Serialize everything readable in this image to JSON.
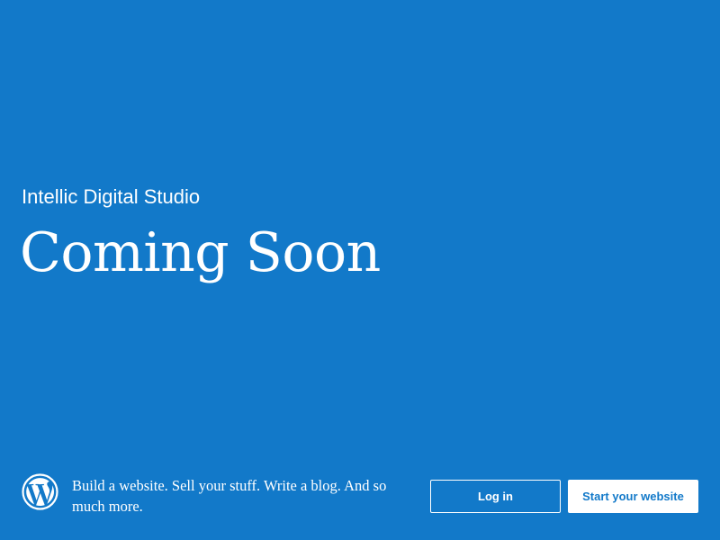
{
  "site": {
    "name": "Intellic Digital Studio",
    "headline": "Coming Soon"
  },
  "footer": {
    "logo_icon": "wordpress-logo-icon",
    "tagline": "Build a website. Sell your stuff. Write a blog. And so much more.",
    "login_label": "Log in",
    "start_label": "Start your website"
  },
  "colors": {
    "background": "#1279c9",
    "text": "#ffffff",
    "button_primary_bg": "#ffffff",
    "button_primary_text": "#1279c9"
  }
}
